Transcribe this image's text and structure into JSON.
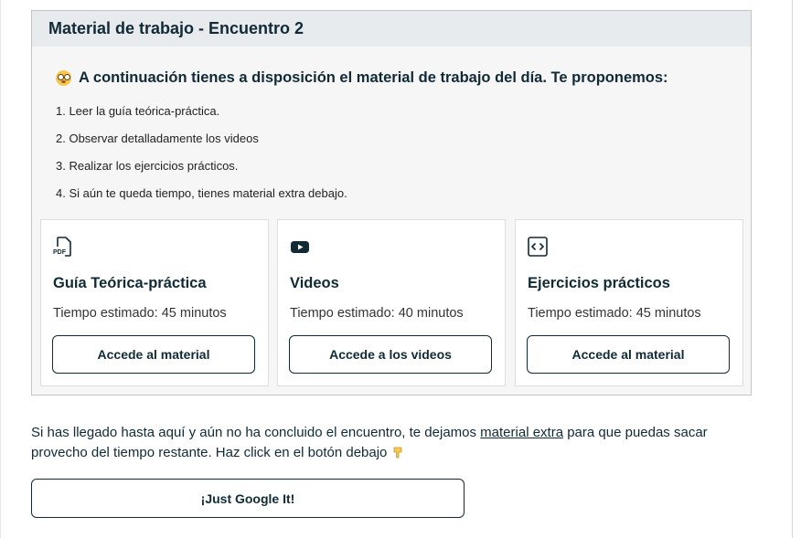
{
  "panel": {
    "title": "Material de trabajo - Encuentro 2",
    "intro": "A continuación tienes a disposición el material de trabajo del día. Te proponemos:",
    "intro_icon": "flushed-face-emoji",
    "steps": [
      "1. Leer la guía teórica-práctica.",
      "2. Observar detalladamente los videos",
      "3. Realizar los ejercicios prácticos.",
      "4. Si aún te queda tiempo, tienes material extra debajo."
    ],
    "cards": [
      {
        "icon": "pdf-file-icon",
        "icon_text": "PDF",
        "title": "Guía Teórica-práctica",
        "time": "Tiempo estimado: 45 minutos",
        "button": "Accede al material"
      },
      {
        "icon": "youtube-icon",
        "title": "Videos",
        "time": "Tiempo estimado: 40 minutos",
        "button": "Accede a los videos"
      },
      {
        "icon": "code-icon",
        "title": "Ejercicios prácticos",
        "time": "Tiempo estimado: 45 minutos",
        "button": "Accede al material"
      }
    ]
  },
  "extra": {
    "text_before": "Si has llegado hasta aquí y aún no ha concluido el encuentro, te dejamos ",
    "link": "material extra",
    "text_after": " para que puedas sacar provecho del tiempo restante. Haz click en el botón debajo ",
    "hand_icon": "pointing-down-hand-emoji",
    "button": "¡Just Google It!"
  },
  "colors": {
    "primary": "#102a36",
    "header_bg": "#e8ebed",
    "panel_bg": "#f6f6f6"
  }
}
